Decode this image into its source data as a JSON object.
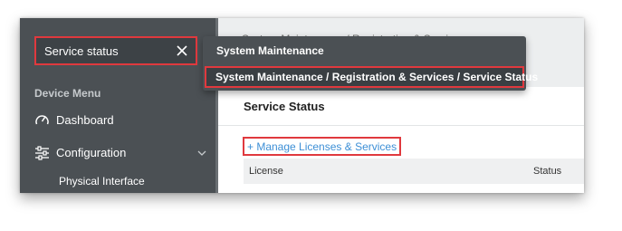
{
  "search": {
    "value": "Service status",
    "close_icon": "close-icon"
  },
  "sidebar": {
    "menu_header": "Device Menu",
    "items": [
      {
        "label": "Dashboard",
        "icon": "gauge-icon"
      },
      {
        "label": "Configuration",
        "icon": "sliders-icon",
        "expanded": true
      }
    ],
    "sub_items": [
      {
        "label": "Physical Interface"
      }
    ]
  },
  "main": {
    "breadcrumb": "System Maintenance / Registration & Services",
    "section_title": "Service Status",
    "manage_link": "+ Manage Licenses & Services",
    "table": {
      "columns": [
        "License",
        "Status"
      ]
    }
  },
  "dropdown": {
    "category": "System Maintenance",
    "result": "System Maintenance / Registration & Services / Service Status"
  },
  "colors": {
    "sidebar_bg": "#4b5054",
    "highlight_border": "#e0393e",
    "link": "#3d8fd6"
  }
}
